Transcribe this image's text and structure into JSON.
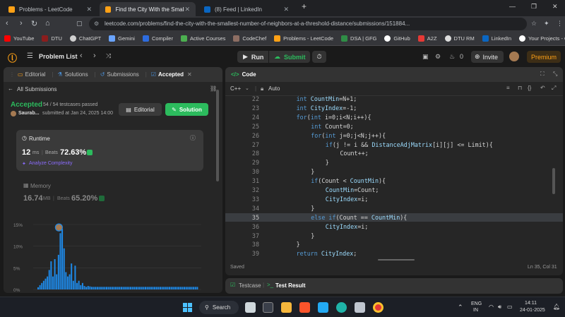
{
  "browser": {
    "tabs": [
      {
        "title": "Problems - LeetCode",
        "active": false
      },
      {
        "title": "Find the City With the Smallest",
        "active": true
      },
      {
        "title": "(8) Feed | LinkedIn",
        "active": false
      }
    ],
    "new_tab": "+",
    "url": "leetcode.com/problems/find-the-city-with-the-smallest-number-of-neighbors-at-a-threshold-distance/submissions/151884...",
    "bookmarks": [
      "YouTube",
      "DTU",
      "ChatGPT",
      "Gemini",
      "Compiler",
      "Active Courses",
      "CodeChef",
      "Problems - LeetCode",
      "DSA | GFG",
      "GitHub",
      "A2Z",
      "DTU RM",
      "LinkedIn",
      "Your Projects - Over..."
    ]
  },
  "lcnav": {
    "problem_list": "Problem List",
    "run": "Run",
    "submit": "Submit",
    "streak": "0",
    "invite": "Invite",
    "premium": "Premium"
  },
  "left": {
    "tabs": [
      "Editorial",
      "Solutions",
      "Submissions",
      "Accepted"
    ],
    "all_submissions": "All Submissions",
    "status": "Accepted",
    "testcases": "54 / 54 testcases passed",
    "user": "Saurab...",
    "submitted": "submitted at Jan 24, 2025 14:00",
    "editorial_btn": "Editorial",
    "solution_btn": "Solution",
    "runtime": {
      "label": "Runtime",
      "value": "12",
      "unit": "ms",
      "beats_label": "Beats",
      "beats": "72.63%",
      "analyze": "Analyze Complexity"
    },
    "memory": {
      "label": "Memory",
      "value": "16.74",
      "unit": "MB",
      "beats_label": "Beats",
      "beats": "65.20%"
    }
  },
  "chart_data": {
    "type": "bar",
    "ylabel": "",
    "y_ticks": [
      "15%",
      "10%",
      "5%",
      "0%"
    ],
    "ylim": [
      0,
      15
    ],
    "values": [
      0.5,
      1,
      1.5,
      2,
      2.5,
      3,
      4.5,
      6.5,
      3,
      7,
      3.5,
      8,
      13,
      14,
      9.5,
      4,
      3,
      3.5,
      6,
      2,
      5.5,
      1.5,
      2,
      1,
      1.5,
      0.8,
      0.6,
      0.8,
      0.7,
      0.6,
      0.6,
      0.6,
      0.6,
      0.6,
      0.6,
      0.6,
      0.6,
      0.6,
      0.6,
      0.6,
      0.6,
      0.6,
      0.6,
      0.6,
      0.6,
      0.6,
      0.6,
      0.6,
      0.6,
      0.6,
      0.6,
      0.6,
      0.6,
      0.6,
      0.6,
      0.6,
      0.6,
      0.6,
      0.6,
      0.6,
      0.6,
      0.6,
      0.6,
      0.6,
      0.6,
      0.6,
      0.6,
      0.6,
      0.6,
      0.6,
      0.6,
      0.6,
      0.6,
      0.6,
      0.6,
      0.6,
      0.6,
      0.6,
      0.6,
      0.6,
      0.6,
      0.6,
      0.6,
      0.6,
      0.6,
      0.6,
      0.6
    ],
    "highlight_index": 13,
    "bar_color": "#1e88e5"
  },
  "editor": {
    "title": "Code",
    "language": "C++",
    "mode": "Auto",
    "lines": [
      {
        "n": "22",
        "indent": 2,
        "text": "int CountMin=N+1;"
      },
      {
        "n": "23",
        "indent": 2,
        "text": "int CityIndex=-1;"
      },
      {
        "n": "24",
        "indent": 2,
        "text": "for(int i=0;i<N;i++){"
      },
      {
        "n": "25",
        "indent": 4,
        "text": "int Count=0;"
      },
      {
        "n": "26",
        "indent": 4,
        "text": "for(int j=0;j<N;j++){"
      },
      {
        "n": "27",
        "indent": 6,
        "text": "if(j != i && DistanceAdjMatrix[i][j] <= Limit){"
      },
      {
        "n": "28",
        "indent": 8,
        "text": "Count++;"
      },
      {
        "n": "29",
        "indent": 6,
        "text": "}"
      },
      {
        "n": "30",
        "indent": 4,
        "text": "}"
      },
      {
        "n": "31",
        "indent": 4,
        "text": "if(Count < CountMin){"
      },
      {
        "n": "32",
        "indent": 6,
        "text": "CountMin=Count;"
      },
      {
        "n": "33",
        "indent": 6,
        "text": "CityIndex=i;"
      },
      {
        "n": "34",
        "indent": 4,
        "text": "}"
      },
      {
        "n": "35",
        "indent": 4,
        "text": "else if(Count == CountMin){"
      },
      {
        "n": "36",
        "indent": 6,
        "text": "CityIndex=i;"
      },
      {
        "n": "37",
        "indent": 4,
        "text": "}"
      },
      {
        "n": "38",
        "indent": 2,
        "text": "}"
      },
      {
        "n": "39",
        "indent": 2,
        "text": "return CityIndex;"
      }
    ],
    "saved": "Saved",
    "position": "Ln 35, Col 31"
  },
  "bottom": {
    "testcase": "Testcase",
    "result": "Test Result"
  },
  "taskbar": {
    "search": "Search",
    "lang1": "ENG",
    "lang2": "IN",
    "time": "14:11",
    "date": "24-01-2025"
  }
}
